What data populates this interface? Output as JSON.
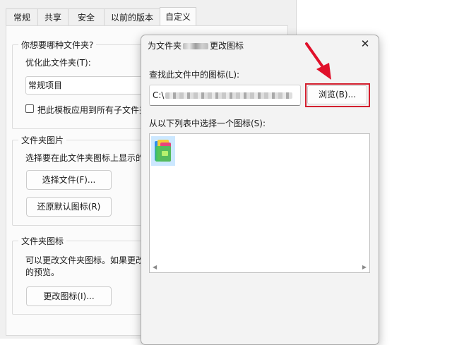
{
  "tabs": [
    {
      "label": "常规"
    },
    {
      "label": "共享"
    },
    {
      "label": "安全"
    },
    {
      "label": "以前的版本"
    },
    {
      "label": "自定义"
    }
  ],
  "optimize": {
    "group_title": "你想要哪种文件夹?",
    "label": "优化此文件夹(T):",
    "selected_value": "常规项目",
    "apply_template_label": "把此模板应用到所有子文件夹"
  },
  "folder_pictures": {
    "group_title": "文件夹图片",
    "description": "选择要在此文件夹图标上显示的",
    "choose_file_button": "选择文件(F)...",
    "restore_default_button": "还原默认图标(R)"
  },
  "folder_icons": {
    "group_title": "文件夹图标",
    "description_line1": "可以更改文件夹图标。如果更改",
    "description_line2": "的预览。",
    "change_icon_button": "更改图标(I)..."
  },
  "dialog": {
    "title_prefix": "为文件夹",
    "title_suffix": "更改图标",
    "close_glyph": "✕",
    "find_label": "查找此文件中的图标(L):",
    "path_visible": "C:\\",
    "browse_button": "浏览(B)...",
    "list_label": "从以下列表中选择一个图标(S):",
    "scroll_left_glyph": "◀",
    "scroll_right_glyph": "▶"
  },
  "colors": {
    "highlight_border": "#d3202f",
    "arrow": "#e0102a",
    "selected_icon_bg": "#cce8ff"
  },
  "icons": {
    "close": "close-icon",
    "folder_icon": "colorful-folder-icon",
    "annotation": "red-arrow-annotation"
  }
}
